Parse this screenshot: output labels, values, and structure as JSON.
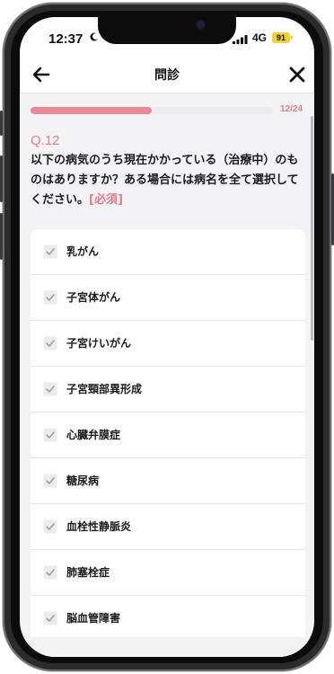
{
  "status_bar": {
    "time": "12:37",
    "network": "4G",
    "battery": "91"
  },
  "header": {
    "title": "問診",
    "back_icon": "arrow-left-icon",
    "close_icon": "close-icon"
  },
  "progress": {
    "label": "12/24",
    "fraction": 0.5
  },
  "question": {
    "number": "Q.12",
    "text": "以下の病気のうち現在かかっている（治療中）のものはありますか？ある場合には病名を全て選択してください。",
    "required": "[必須]"
  },
  "options": [
    {
      "label": "乳がん"
    },
    {
      "label": "子宮体がん"
    },
    {
      "label": "子宮けいがん"
    },
    {
      "label": "子宮頸部異形成"
    },
    {
      "label": "心臓弁膜症"
    },
    {
      "label": "糖尿病"
    },
    {
      "label": "血栓性静脈炎"
    },
    {
      "label": "肺塞栓症"
    },
    {
      "label": "脳血管障害"
    }
  ],
  "colors": {
    "accent": "#e07d8b",
    "progress": "#e98a96",
    "background": "#f3f3f5"
  }
}
